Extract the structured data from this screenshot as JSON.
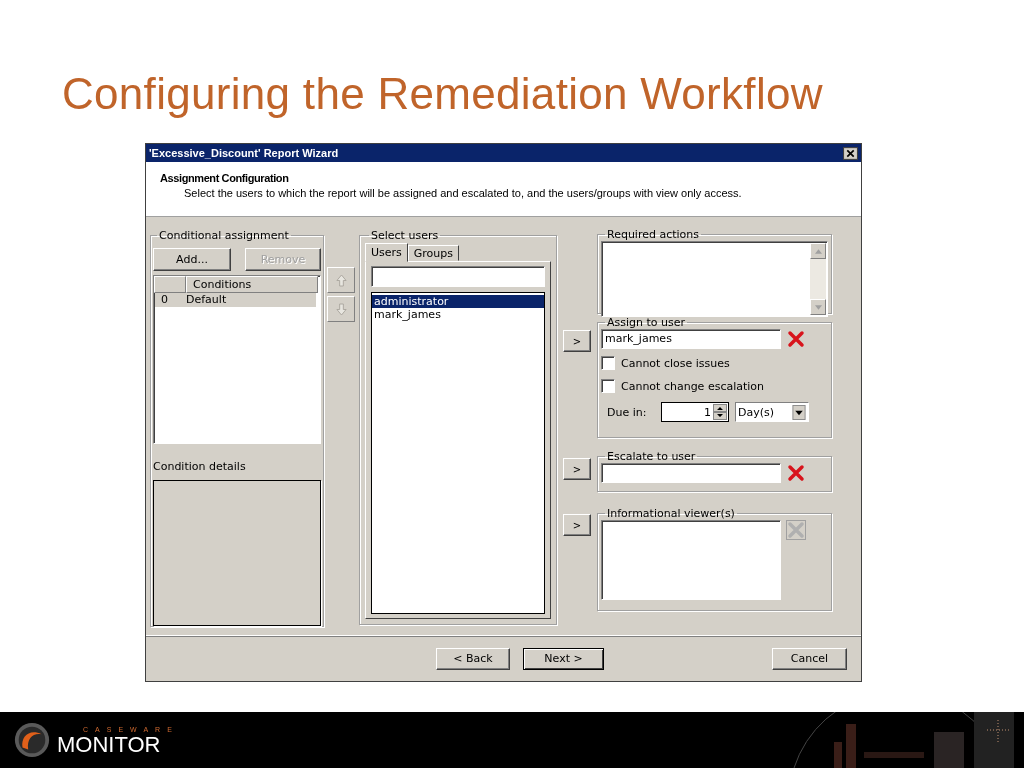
{
  "slide": {
    "title": "Configuring the Remediation Workflow"
  },
  "window": {
    "title": "'Excessive_Discount' Report Wizard"
  },
  "header": {
    "heading": "Assignment Configuration",
    "description": "Select the users to which the report will be assigned and escalated to, and the users/groups with view only access."
  },
  "conditional_assignment": {
    "label": "Conditional assignment",
    "buttons": [
      {
        "label": "Add...",
        "disabled": false
      },
      {
        "label": "Remove",
        "disabled": true
      }
    ],
    "index_column": "Conditions",
    "rows": [
      {
        "index": "0",
        "condition": "Default",
        "selected": true
      }
    ],
    "details_label": "Condition details"
  },
  "select_users": {
    "label": "Select users",
    "tabs": [
      {
        "label": "Users",
        "selected": true
      },
      {
        "label": "Groups",
        "selected": false
      }
    ],
    "users": [
      {
        "name": "administrator",
        "selected": true
      },
      {
        "name": "mark_james",
        "selected": false
      }
    ]
  },
  "required_actions": {
    "label": "Required actions"
  },
  "assign": {
    "label": "Assign to user",
    "add_button": ">",
    "value": "mark_james",
    "clear_enabled": true,
    "options": [
      {
        "label": "Cannot close issues",
        "checked": false
      },
      {
        "label": "Cannot change escalation",
        "checked": false
      }
    ],
    "due_label": "Due in:",
    "due_value": "1",
    "due_unit": "Day(s)"
  },
  "escalate": {
    "label": "Escalate to user",
    "add_button": ">",
    "clear_enabled": true
  },
  "viewers": {
    "label": "Informational viewer(s)",
    "add_button": ">",
    "clear_enabled": false
  },
  "buttons": [
    {
      "label": "< Back",
      "default": false
    },
    {
      "label": "Next >",
      "default": true
    },
    {
      "label": "Cancel",
      "default": false
    }
  ],
  "footer": {
    "brand_top": "CASEWARE",
    "brand": "MONITOR"
  }
}
